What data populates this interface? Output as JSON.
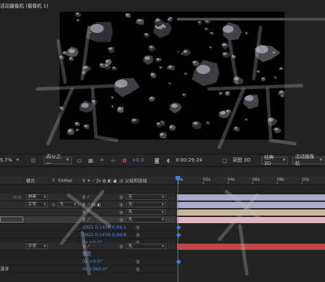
{
  "viewer": {
    "tab_title": "活动摄像机 (摄像机 1)"
  },
  "viewer_footer": {
    "zoom": "5.7%",
    "resolution": "四分之一",
    "exposure": "+0.0",
    "timecode": "0:00:29:24",
    "renderer": "草图 3D",
    "view_layout": "经典 3D",
    "camera_view": "活动摄像机"
  },
  "timeline": {
    "header": {
      "mode": "模式",
      "t": "T",
      "trkmat": "TrkMat",
      "parent_link": "父级和链接"
    },
    "ruler_labels": [
      "0s",
      "02s",
      "04s",
      "06s",
      "08s",
      "10s"
    ],
    "rows": [
      {
        "mode": "屏幕",
        "parent": "无"
      },
      {
        "mode": "正常",
        "trkmat": "无",
        "parent": "无"
      },
      {
        "parent": "无"
      },
      {
        "parent": "无"
      },
      {
        "value": "1921.0,1416.0,69.1"
      },
      {
        "value": "1921.0,1416.0,69.8"
      },
      {
        "value": "0x +0.0°"
      },
      {
        "mode": "正常",
        "parent": "无"
      },
      {
        "label": "重置"
      },
      {
        "value": "0x +0.0°"
      },
      {
        "left_label": "漂浮",
        "value": "0x +360.0°"
      }
    ]
  },
  "colors": {
    "playhead": "#3d7be0",
    "track_lavender": "#a9abc8",
    "track_tan": "#c7b89a",
    "track_pink": "#e0b6c3",
    "track_red": "#b84b4b",
    "value_blue": "#4c8ee6"
  }
}
